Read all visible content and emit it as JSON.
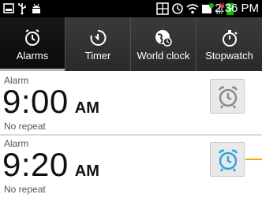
{
  "status_bar": {
    "time": "2:36 PM",
    "icons": [
      "notification-icon",
      "usb-icon",
      "android-icon",
      "media-icon",
      "sync-icon",
      "wifi-icon",
      "alert-icon",
      "no-signal-icon",
      "battery-charging-icon"
    ],
    "accent": "#00c000"
  },
  "tabs": [
    {
      "label": "Alarms",
      "icon": "alarm-clock-icon",
      "active": true
    },
    {
      "label": "Timer",
      "icon": "timer-icon",
      "active": false
    },
    {
      "label": "World clock",
      "icon": "globe-clock-icon",
      "active": false
    },
    {
      "label": "Stopwatch",
      "icon": "stopwatch-icon",
      "active": false
    }
  ],
  "alarms": [
    {
      "label": "Alarm",
      "time": "9:00",
      "ampm": "AM",
      "repeat": "No repeat",
      "enabled": false,
      "toggle_color": "#8a8a8a"
    },
    {
      "label": "Alarm",
      "time": "9:20",
      "ampm": "AM",
      "repeat": "No repeat",
      "enabled": true,
      "toggle_color": "#2aa8d8"
    }
  ]
}
